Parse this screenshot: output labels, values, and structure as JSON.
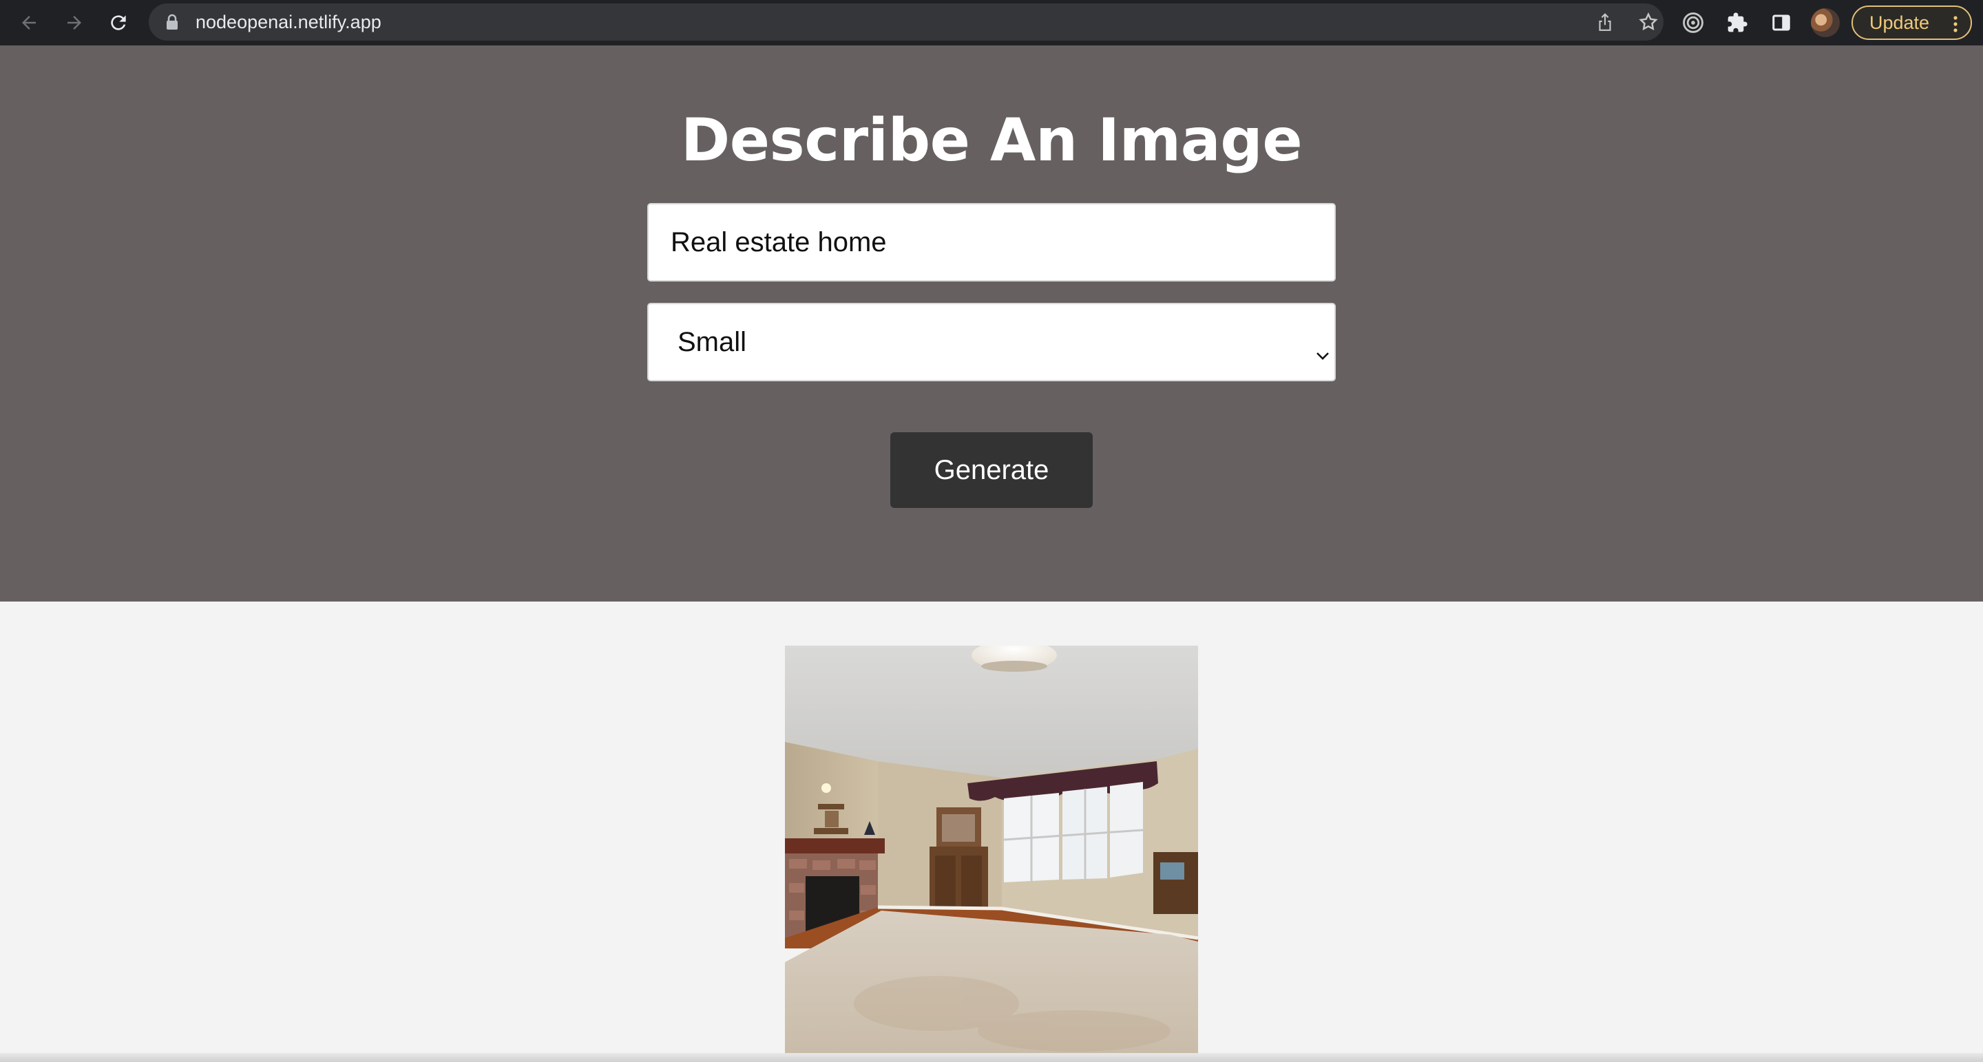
{
  "browser": {
    "url": "nodeopenai.netlify.app",
    "update_label": "Update"
  },
  "page": {
    "title": "Describe An Image",
    "prompt_value": "Real estate home",
    "size_selected": "Small",
    "generate_label": "Generate"
  },
  "colors": {
    "hero_bg": "#666060",
    "button_bg": "#333333",
    "page_bg": "#f3f3f3",
    "update_accent": "#f0ca7b"
  },
  "icons": [
    "back-arrow-icon",
    "forward-arrow-icon",
    "reload-icon",
    "lock-icon",
    "share-icon",
    "star-icon",
    "extension-circle-icon",
    "puzzle-icon",
    "side-panel-icon",
    "chevron-down-icon",
    "kebab-menu-icon"
  ]
}
